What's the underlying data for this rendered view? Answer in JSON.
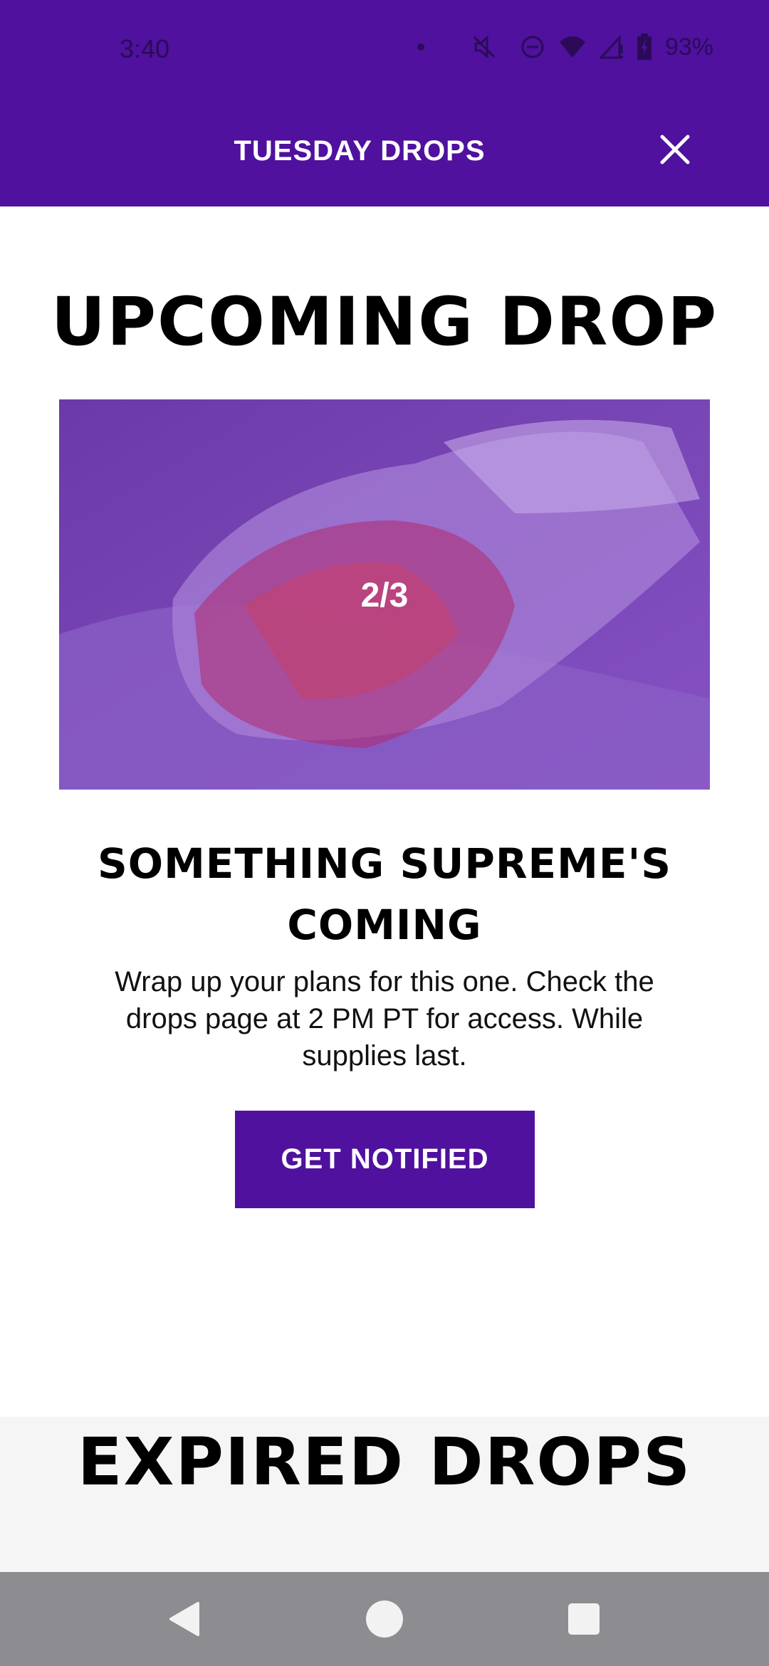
{
  "status_bar": {
    "time": "3:40",
    "battery_percent": "93%",
    "icons": [
      "dot-icon",
      "mute-icon",
      "dnd-icon",
      "wifi-icon",
      "signal-icon",
      "battery-icon"
    ]
  },
  "header": {
    "title": "TUESDAY DROPS",
    "close_icon": "close-icon"
  },
  "upcoming": {
    "section_title": "UPCOMING DROP",
    "image_counter": "2/3",
    "heading": "SOMETHING SUPREME'S COMING",
    "description": "Wrap up your plans for this one. Check the drops page at 2 PM PT for access. While supplies last.",
    "button_label": "GET NOTIFIED"
  },
  "expired": {
    "section_title": "EXPIRED DROPS"
  },
  "nav": {
    "icons": [
      "back-icon",
      "home-icon",
      "recents-icon"
    ]
  },
  "colors": {
    "brand_purple": "#4f119e",
    "image_overlay": "#7a45b7",
    "nav_bar": "#8c8c91"
  }
}
